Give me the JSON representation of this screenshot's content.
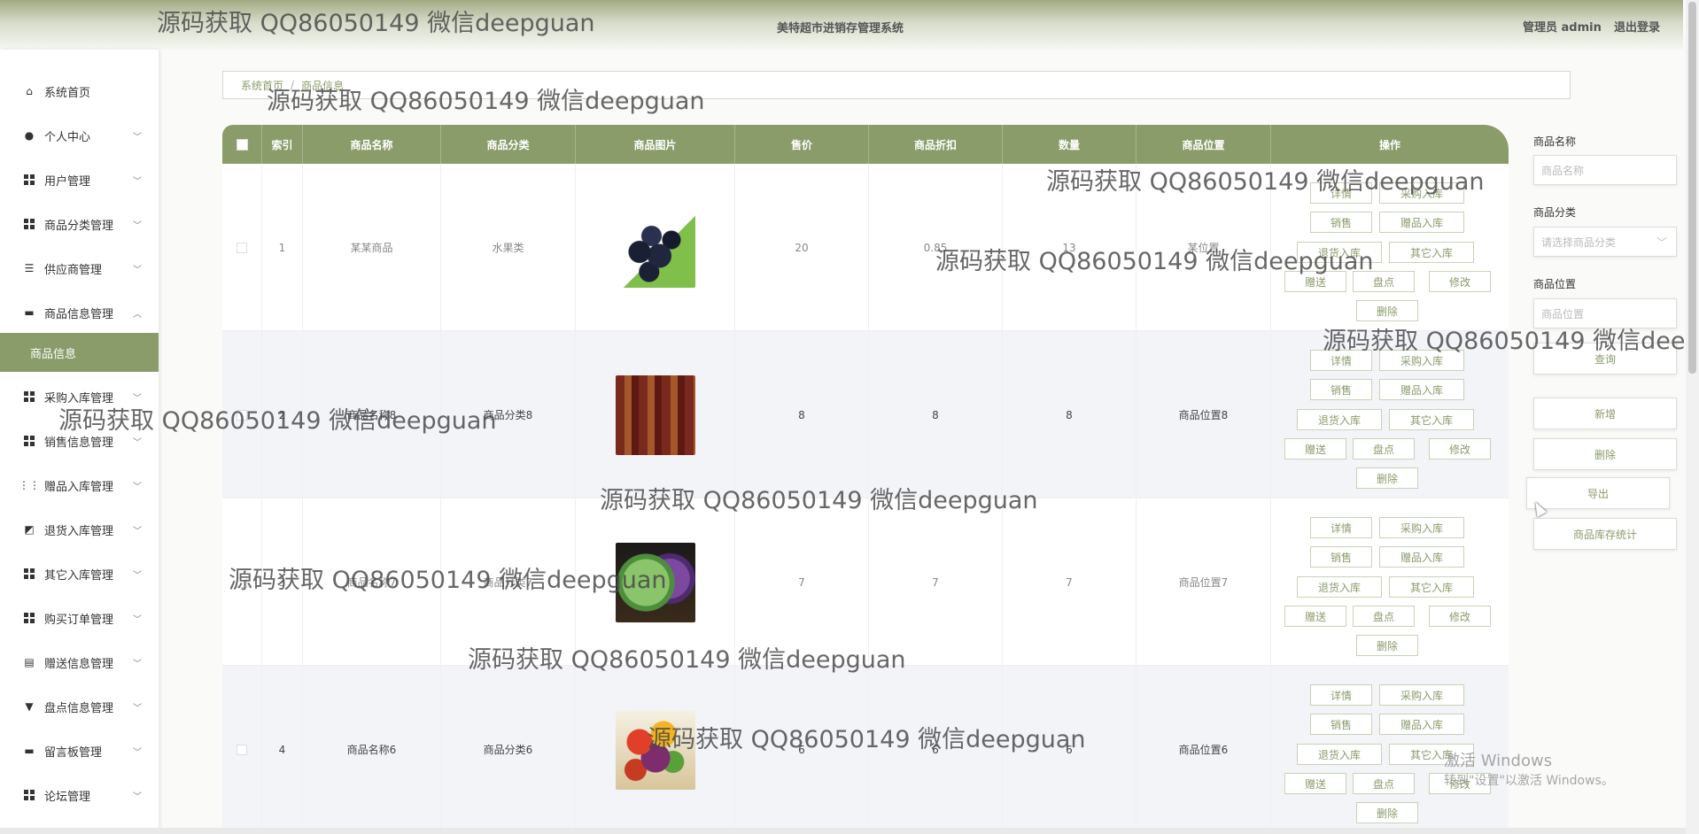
{
  "header": {
    "system_title": "美特超市进销存管理系统",
    "user_label": "管理员 admin",
    "logout_label": "退出登录"
  },
  "sidebar": {
    "items": [
      {
        "label": "系统首页",
        "icon": "home-icon"
      },
      {
        "label": "个人中心",
        "icon": "user-icon"
      },
      {
        "label": "用户管理",
        "icon": "grid-icon"
      },
      {
        "label": "商品分类管理",
        "icon": "grid-icon"
      },
      {
        "label": "供应商管理",
        "icon": "list-icon"
      },
      {
        "label": "商品信息管理",
        "icon": "chat-icon"
      },
      {
        "label": "采购入库管理",
        "icon": "grid-icon"
      },
      {
        "label": "销售信息管理",
        "icon": "grid-icon"
      },
      {
        "label": "赠品入库管理",
        "icon": "apps-icon"
      },
      {
        "label": "退货入库管理",
        "icon": "tag-icon"
      },
      {
        "label": "其它入库管理",
        "icon": "grid-icon"
      },
      {
        "label": "购买订单管理",
        "icon": "grid-icon"
      },
      {
        "label": "赠送信息管理",
        "icon": "clipboard-icon"
      },
      {
        "label": "盘点信息管理",
        "icon": "trophy-icon"
      },
      {
        "label": "留言板管理",
        "icon": "printer-icon"
      },
      {
        "label": "论坛管理",
        "icon": "grid-icon"
      }
    ],
    "active_sub": "商品信息"
  },
  "breadcrumb": {
    "home": "系统首页",
    "current": "商品信息"
  },
  "table": {
    "headers": [
      "索引",
      "商品名称",
      "商品分类",
      "商品图片",
      "售价",
      "商品折扣",
      "数量",
      "商品位置",
      "操作"
    ],
    "rows": [
      {
        "index": "1",
        "name": "某某商品",
        "category": "水果类",
        "image": "grapes-image",
        "price": "20",
        "discount": "0.85",
        "qty": "13",
        "location": "某位置"
      },
      {
        "index": "2",
        "name": "商品名称8",
        "category": "商品分类8",
        "image": "market-image",
        "price": "8",
        "discount": "8",
        "qty": "8",
        "location": "商品位置8"
      },
      {
        "index": "3",
        "name": "商品名称7",
        "category": "商品分类7",
        "image": "cabbage-image",
        "price": "7",
        "discount": "7",
        "qty": "7",
        "location": "商品位置7"
      },
      {
        "index": "4",
        "name": "商品名称6",
        "category": "商品分类6",
        "image": "fruit-basket-image",
        "price": "6",
        "discount": "6",
        "qty": "6",
        "location": "商品位置6"
      }
    ],
    "actions": [
      "详情",
      "采购入库",
      "销售",
      "赠品入库",
      "退货入库",
      "其它入库",
      "赠送",
      "盘点",
      "修改",
      "删除"
    ]
  },
  "search": {
    "name_label": "商品名称",
    "name_placeholder": "商品名称",
    "category_label": "商品分类",
    "category_placeholder": "请选择商品分类",
    "location_label": "商品位置",
    "location_placeholder": "商品位置",
    "query": "查询",
    "add": "新增",
    "delete": "删除",
    "export": "导出",
    "stats": "商品库存统计"
  },
  "watermark": "源码获取 QQ86050149 微信deepguan",
  "windows_activation": {
    "line1": "激活 Windows",
    "line2": "转到\"设置\"以激活 Windows。"
  },
  "colors": {
    "accent": "#8a9c6a",
    "header_top": "#a2aa83"
  }
}
